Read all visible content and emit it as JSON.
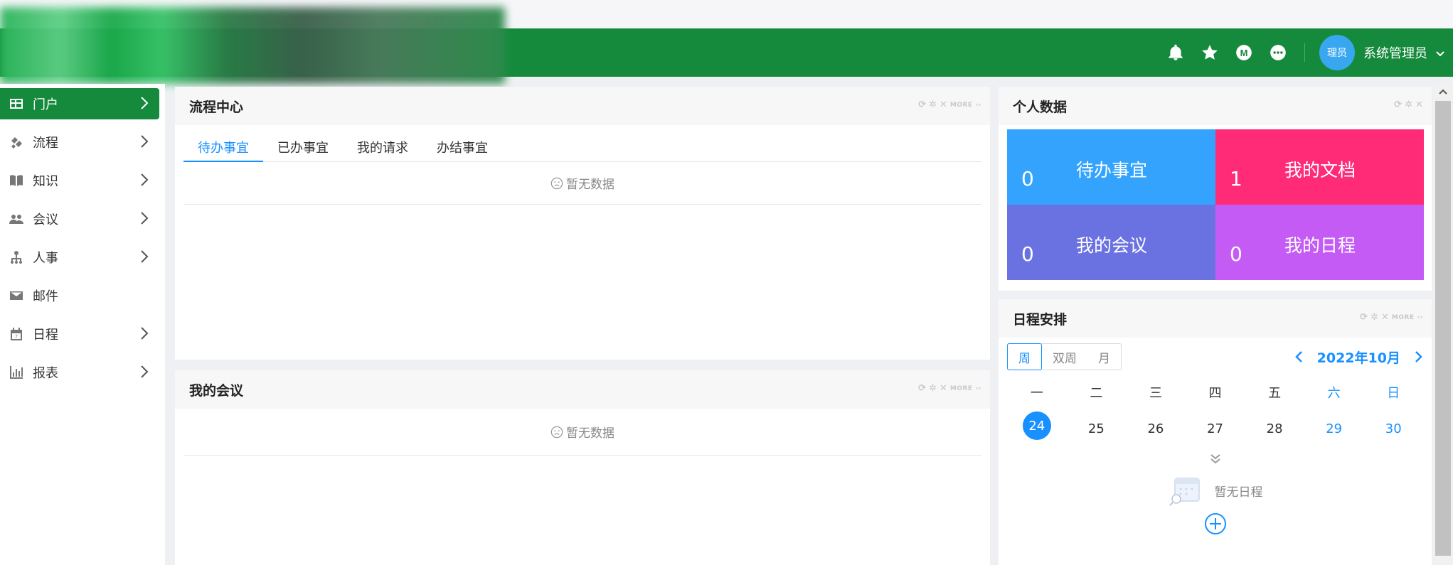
{
  "header": {
    "user_avatar_text": "理员",
    "username": "系统管理员",
    "colors": {
      "brand": "#158a3c",
      "accent": "#1890ff"
    }
  },
  "sidebar": {
    "items": [
      {
        "label": "门户",
        "icon": "dashboard-icon",
        "active": true,
        "has_children": true
      },
      {
        "label": "流程",
        "icon": "workflow-icon",
        "has_children": true
      },
      {
        "label": "知识",
        "icon": "book-icon",
        "has_children": true
      },
      {
        "label": "会议",
        "icon": "people-icon",
        "has_children": true
      },
      {
        "label": "人事",
        "icon": "org-chart-icon",
        "has_children": true
      },
      {
        "label": "邮件",
        "icon": "mail-icon",
        "has_children": false
      },
      {
        "label": "日程",
        "icon": "calendar-icon",
        "has_children": true
      },
      {
        "label": "报表",
        "icon": "bar-chart-icon",
        "has_children": true
      }
    ]
  },
  "workflow_panel": {
    "title": "流程中心",
    "more": "MORE",
    "tabs": [
      "待办事宜",
      "已办事宜",
      "我的请求",
      "办结事宜"
    ],
    "active_tab": "待办事宜",
    "empty_text": "暂无数据"
  },
  "meeting_panel": {
    "title": "我的会议",
    "more": "MORE",
    "empty_text": "暂无数据"
  },
  "personal_panel": {
    "title": "个人数据",
    "tiles": [
      {
        "label": "待办事宜",
        "count": "0",
        "color": "#33a3fd"
      },
      {
        "label": "我的文档",
        "count": "1",
        "color": "#ff2b76"
      },
      {
        "label": "我的会议",
        "count": "0",
        "color": "#6a71e1"
      },
      {
        "label": "我的日程",
        "count": "0",
        "color": "#c45bf5"
      }
    ]
  },
  "schedule_panel": {
    "title": "日程安排",
    "more": "MORE",
    "views": [
      "周",
      "双周",
      "月"
    ],
    "active_view": "周",
    "month_label": "2022年10月",
    "weekdays": [
      "一",
      "二",
      "三",
      "四",
      "五",
      "六",
      "日"
    ],
    "dates": [
      "24",
      "25",
      "26",
      "27",
      "28",
      "29",
      "30"
    ],
    "today": "24",
    "empty_text": "暂无日程"
  }
}
